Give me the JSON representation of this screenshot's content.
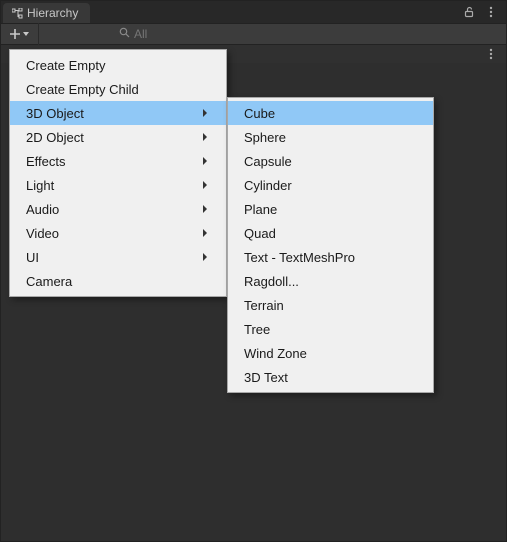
{
  "tab": {
    "title": "Hierarchy"
  },
  "search": {
    "placeholder": "All"
  },
  "menu1": {
    "items": [
      {
        "label": "Create Empty",
        "submenu": false
      },
      {
        "label": "Create Empty Child",
        "submenu": false
      },
      {
        "label": "3D Object",
        "submenu": true,
        "highlight": true
      },
      {
        "label": "2D Object",
        "submenu": true
      },
      {
        "label": "Effects",
        "submenu": true
      },
      {
        "label": "Light",
        "submenu": true
      },
      {
        "label": "Audio",
        "submenu": true
      },
      {
        "label": "Video",
        "submenu": true
      },
      {
        "label": "UI",
        "submenu": true
      },
      {
        "label": "Camera",
        "submenu": false
      }
    ]
  },
  "menu2": {
    "items": [
      {
        "label": "Cube",
        "highlight": true
      },
      {
        "label": "Sphere"
      },
      {
        "label": "Capsule"
      },
      {
        "label": "Cylinder"
      },
      {
        "label": "Plane"
      },
      {
        "label": "Quad"
      },
      {
        "label": "Text - TextMeshPro"
      },
      {
        "label": "Ragdoll..."
      },
      {
        "label": "Terrain"
      },
      {
        "label": "Tree"
      },
      {
        "label": "Wind Zone"
      },
      {
        "label": "3D Text"
      }
    ]
  }
}
